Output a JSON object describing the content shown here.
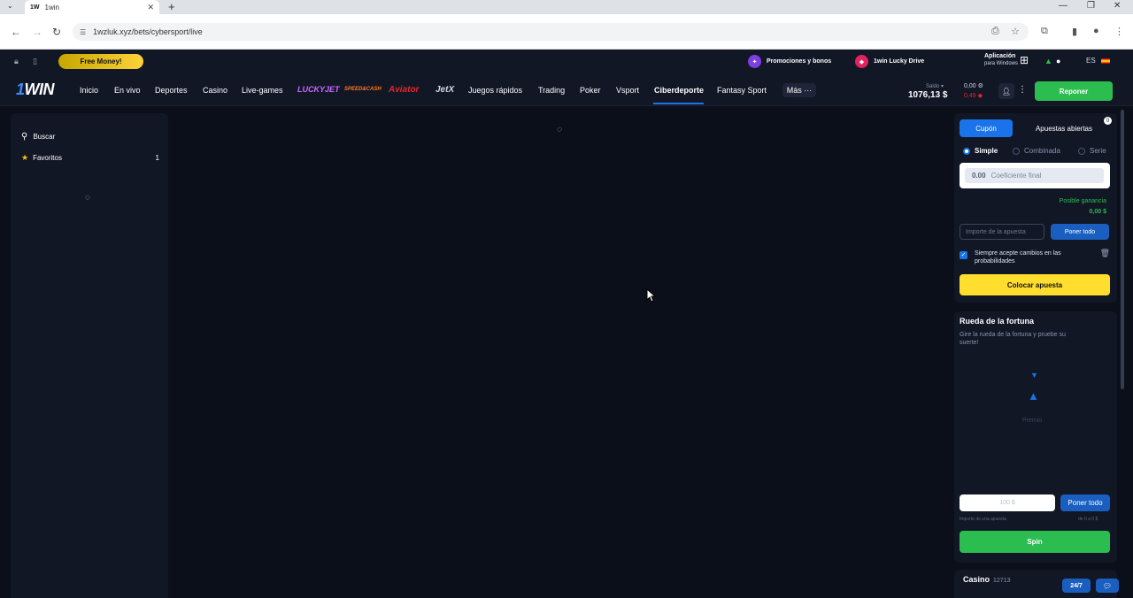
{
  "browser": {
    "tab_title": "1win",
    "tab_favicon": "1W",
    "url": "1wzluk.xyz/bets/cybersport/live"
  },
  "topbar": {
    "free_money": "Free Money!",
    "promo_label": "Promociones y bonos",
    "lucky_drive": "1win Lucky Drive",
    "app_line1": "Aplicación",
    "app_line2": "para Windows",
    "lang": "ES"
  },
  "nav": {
    "logo_one": "1",
    "logo_win": "WIN",
    "items": [
      "Inicio",
      "En vivo",
      "Deportes",
      "Casino",
      "Live-games"
    ],
    "brands": [
      "LUCKYJET",
      "SPEED&CASH",
      "Aviator",
      "JetX"
    ],
    "items2": [
      "Juegos rápidos",
      "Trading",
      "Poker",
      "Vsport",
      "Ciberdeporte",
      "Fantasy Sport"
    ],
    "more": "Más ···",
    "balance_label": "Saldo ▾",
    "balance": "1076,13 $",
    "bal_small1": "0,00",
    "bal_small2": "0,49",
    "reponer": "Reponer"
  },
  "sidebar": {
    "search": "Buscar",
    "favorites": "Favoritos",
    "favorites_count": "1"
  },
  "coupon": {
    "tab_active": "Cupón",
    "tab_open": "Apuestas abiertas",
    "badge": "0",
    "radio_simple": "Simple",
    "radio_combinada": "Combinada",
    "radio_serie": "Serie",
    "coef_value": "0.00",
    "coef_label": "Coeficiente final",
    "posible_label": "Posible ganancia",
    "posible_value": "0,00 $",
    "amount_placeholder": "Importe de la apuesta",
    "poner_todo": "Poner todo",
    "accept_text": "Siempre acepte cambios en las probabilidades",
    "colocar": "Colocar apuesta"
  },
  "fortune": {
    "title": "Rueda de la fortuna",
    "desc": "Gire la rueda de la fortuna y pruebe su suerte!",
    "premio": "Premio",
    "input_placeholder": "100 $",
    "poner_todo": "Poner todo",
    "note_left": "Importe de una apuesta",
    "note_right": "de 0 a 0 $",
    "spin": "Spin"
  },
  "casino": {
    "title": "Casino",
    "count": "12713",
    "support": "24/7"
  },
  "colors": {
    "accent_blue": "#1a73e8",
    "green": "#2bbd4f",
    "yellow": "#ffde2e",
    "bg": "#0b0f1a",
    "panel": "#121726"
  }
}
